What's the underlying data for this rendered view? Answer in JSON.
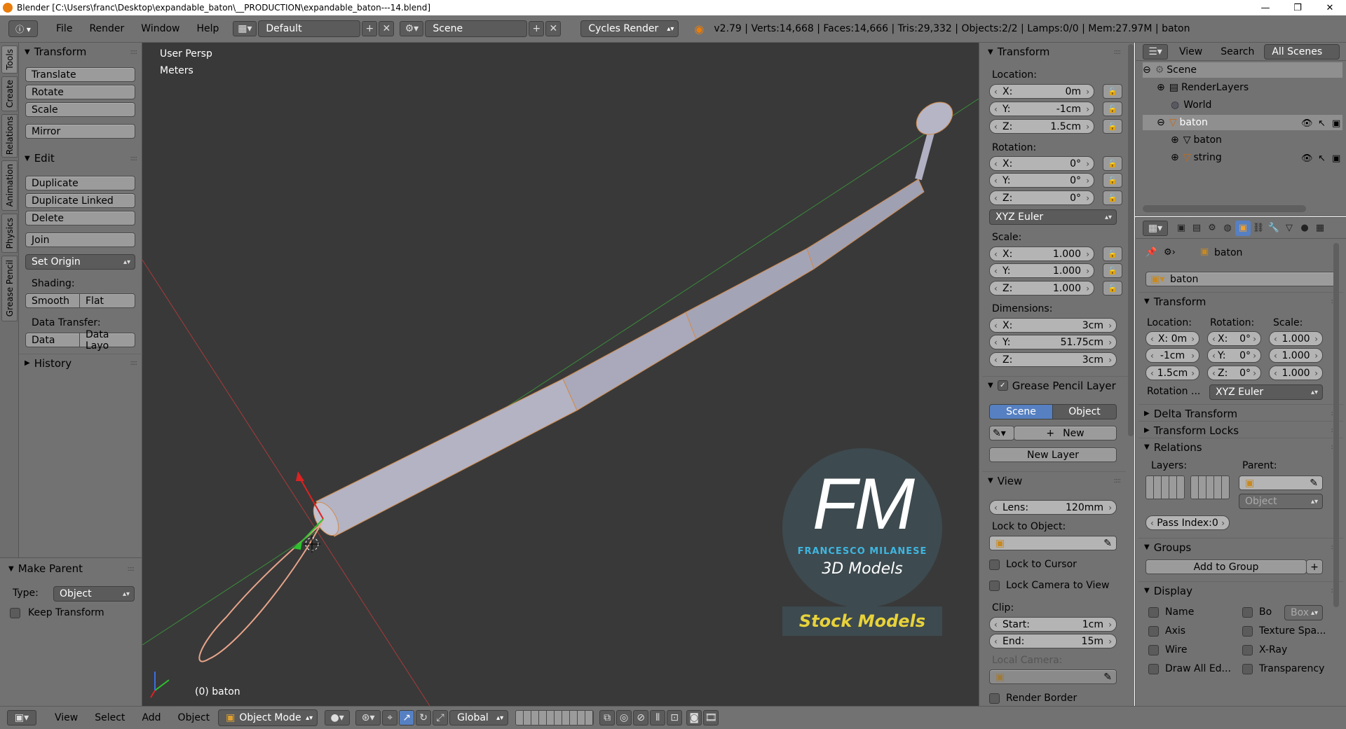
{
  "window": {
    "title": "Blender [C:\\Users\\franc\\Desktop\\expandable_baton\\__PRODUCTION\\expandable_baton---14.blend]",
    "controls": [
      "—",
      "❐",
      "✕"
    ]
  },
  "infobar": {
    "menus": [
      "File",
      "Render",
      "Window",
      "Help"
    ],
    "screen_layout": "Default",
    "scene": "Scene",
    "render_engine": "Cycles Render",
    "stats": "v2.79 | Verts:14,668 | Faces:14,666 | Tris:29,332 | Objects:2/2 | Lamps:0/0 | Mem:27.97M | baton"
  },
  "tool_tabs": [
    "Tools",
    "Create",
    "Relations",
    "Animation",
    "Physics",
    "Grease Pencil"
  ],
  "toolshelf": {
    "transform": {
      "title": "Transform",
      "buttons": [
        "Translate",
        "Rotate",
        "Scale",
        "Mirror"
      ]
    },
    "edit": {
      "title": "Edit",
      "buttons": [
        "Duplicate",
        "Duplicate Linked",
        "Delete",
        "Join"
      ],
      "set_origin": "Set Origin",
      "shading_label": "Shading:",
      "smooth": "Smooth",
      "flat": "Flat",
      "data_transfer_label": "Data Transfer:",
      "data": "Data",
      "data_layout": "Data Layo"
    },
    "history": {
      "title": "History"
    }
  },
  "make_parent": {
    "title": "Make Parent",
    "type_label": "Type:",
    "type_value": "Object",
    "keep_transform": "Keep Transform"
  },
  "viewport": {
    "view_name": "User Persp",
    "units": "Meters",
    "active_object": "(0) baton",
    "watermark": {
      "initials": "FM",
      "author": "FRANCESCO MILANESE",
      "subtitle": "3D Models",
      "banner": "Stock Models"
    }
  },
  "npanel": {
    "transform_title": "Transform",
    "location_label": "Location:",
    "location": [
      {
        "k": "X:",
        "v": "0m"
      },
      {
        "k": "Y:",
        "v": "-1cm"
      },
      {
        "k": "Z:",
        "v": "1.5cm"
      }
    ],
    "rotation_label": "Rotation:",
    "rotation": [
      {
        "k": "X:",
        "v": "0°"
      },
      {
        "k": "Y:",
        "v": "0°"
      },
      {
        "k": "Z:",
        "v": "0°"
      }
    ],
    "rotation_mode": "XYZ Euler",
    "scale_label": "Scale:",
    "scale": [
      {
        "k": "X:",
        "v": "1.000"
      },
      {
        "k": "Y:",
        "v": "1.000"
      },
      {
        "k": "Z:",
        "v": "1.000"
      }
    ],
    "dimensions_label": "Dimensions:",
    "dimensions": [
      {
        "k": "X:",
        "v": "3cm"
      },
      {
        "k": "Y:",
        "v": "51.75cm"
      },
      {
        "k": "Z:",
        "v": "3cm"
      }
    ],
    "grease_pencil_title": "Grease Pencil Layer",
    "gp_scene": "Scene",
    "gp_object": "Object",
    "gp_new": "New",
    "gp_new_layer": "New Layer",
    "view_title": "View",
    "lens_label": "Lens:",
    "lens_value": "120mm",
    "lock_to_object": "Lock to Object:",
    "lock_to_cursor": "Lock to Cursor",
    "lock_camera": "Lock Camera to View",
    "clip_label": "Clip:",
    "clip_start": {
      "k": "Start:",
      "v": "1cm"
    },
    "clip_end": {
      "k": "End:",
      "v": "15m"
    },
    "local_camera": "Local Camera:",
    "render_border": "Render Border"
  },
  "outliner": {
    "view": "View",
    "search": "Search",
    "filter": "All Scenes",
    "items": [
      "Scene",
      "RenderLayers",
      "World",
      "baton",
      "baton",
      "string"
    ]
  },
  "properties": {
    "breadcrumb": "baton",
    "object_name": "baton",
    "transform_title": "Transform",
    "location_label": "Location:",
    "rotation_label": "Rotation:",
    "scale_label": "Scale:",
    "loc": [
      "X: 0m",
      "-1cm",
      "1.5cm"
    ],
    "rot": [
      {
        "k": "X:",
        "v": "0°"
      },
      {
        "k": "Y:",
        "v": "0°"
      },
      {
        "k": "Z:",
        "v": "0°"
      }
    ],
    "scl": [
      "1.000",
      "1.000",
      "1.000"
    ],
    "rotation_mode_label": "Rotation ...",
    "rotation_mode": "XYZ Euler",
    "delta_transform": "Delta Transform",
    "transform_locks": "Transform Locks",
    "relations": "Relations",
    "layers_label": "Layers:",
    "parent_label": "Parent:",
    "parent_type": "Object",
    "pass_index": "Pass Index:0",
    "groups": "Groups",
    "add_to_group": "Add to Group",
    "display": "Display",
    "display_opts": [
      "Name",
      "Bo",
      "Box",
      "Axis",
      "Texture Spa...",
      "Wire",
      "X-Ray",
      "Draw All Ed...",
      "Transparency"
    ]
  },
  "bottombar": {
    "menus": [
      "View",
      "Select",
      "Add",
      "Object"
    ],
    "mode": "Object Mode",
    "orientation": "Global"
  }
}
